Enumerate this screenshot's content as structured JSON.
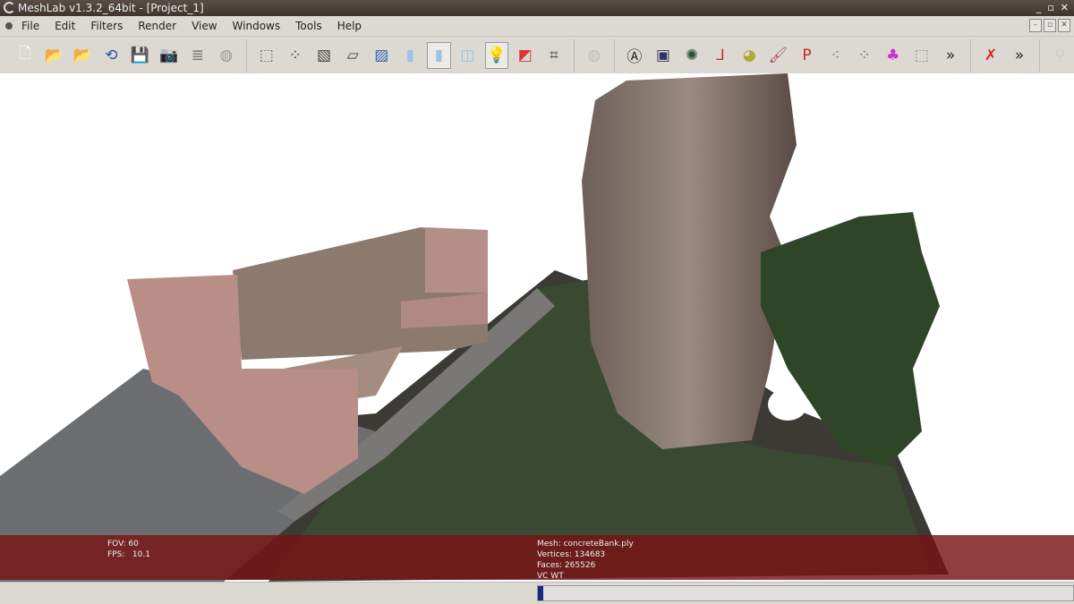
{
  "window": {
    "title": "MeshLab v1.3.2_64bit - [Project_1]",
    "controls": [
      "_",
      "▫",
      "✕"
    ]
  },
  "menu": [
    "File",
    "Edit",
    "Filters",
    "Render",
    "View",
    "Windows",
    "Tools",
    "Help"
  ],
  "mdi_controls": [
    "–",
    "▫",
    "✕"
  ],
  "toolbar": {
    "groups": [
      [
        {
          "name": "new-icon",
          "glyph": "🗋",
          "color": "#fff"
        },
        {
          "name": "open-project-icon",
          "glyph": "📂",
          "color": "#c8c820"
        },
        {
          "name": "import-mesh-icon",
          "glyph": "📂",
          "color": "#c8c820"
        },
        {
          "name": "reload-icon",
          "glyph": "⟲",
          "color": "#3355aa"
        },
        {
          "name": "save-icon",
          "glyph": "💾",
          "color": "#555"
        },
        {
          "name": "snapshot-icon",
          "glyph": "📷",
          "color": "#2a8"
        },
        {
          "name": "layers-icon",
          "glyph": "≣",
          "color": "#777"
        },
        {
          "name": "globe-icon",
          "glyph": "◍",
          "color": "#999"
        }
      ],
      [
        {
          "name": "bbox-icon",
          "glyph": "⬚",
          "color": "#666"
        },
        {
          "name": "points-icon",
          "glyph": "⁘",
          "color": "#444"
        },
        {
          "name": "wireframe-icon",
          "glyph": "▧",
          "color": "#444"
        },
        {
          "name": "hidden-lines-icon",
          "glyph": "▱",
          "color": "#444"
        },
        {
          "name": "flat-lines-icon",
          "glyph": "▨",
          "color": "#3366aa"
        },
        {
          "name": "flat-icon",
          "glyph": "▮",
          "color": "#9bc3e8"
        },
        {
          "name": "smooth-icon",
          "glyph": "▮",
          "color": "#9bc3e8",
          "on": true
        },
        {
          "name": "texture-icon",
          "glyph": "◫",
          "color": "#9bc3e8"
        },
        {
          "name": "light-icon",
          "glyph": "💡",
          "color": "#ee0",
          "on": true
        },
        {
          "name": "double-side-icon",
          "glyph": "◩",
          "color": "#d33"
        },
        {
          "name": "normals-icon",
          "glyph": "⌗",
          "color": "#555"
        }
      ],
      [
        {
          "name": "trackball-icon",
          "glyph": "◍",
          "color": "#bbb"
        }
      ],
      [
        {
          "name": "annotation-icon",
          "glyph": "Ⓐ",
          "color": "#222"
        },
        {
          "name": "shader-icon",
          "glyph": "▣",
          "color": "#336"
        },
        {
          "name": "paint-mesh-icon",
          "glyph": "✺",
          "color": "#253"
        },
        {
          "name": "axes-icon",
          "glyph": "⅃",
          "color": "#c33"
        },
        {
          "name": "measure-icon",
          "glyph": "◕",
          "color": "#aa3"
        },
        {
          "name": "brush-icon",
          "glyph": "🖌",
          "color": "#a55"
        },
        {
          "name": "pp-icon",
          "glyph": "P",
          "color": "#c22"
        },
        {
          "name": "select-vertices-icon",
          "glyph": "⁖",
          "color": "#777"
        },
        {
          "name": "select-connected-icon",
          "glyph": "⁘",
          "color": "#776"
        },
        {
          "name": "color-paint-icon",
          "glyph": "♣",
          "color": "#c3c"
        },
        {
          "name": "select-faces-icon",
          "glyph": "⬚",
          "color": "#888"
        },
        {
          "name": "more-icon",
          "glyph": "»",
          "color": "#222"
        }
      ],
      [
        {
          "name": "delete-icon",
          "glyph": "✗",
          "color": "#d22"
        },
        {
          "name": "more-icon",
          "glyph": "»",
          "color": "#222"
        }
      ],
      [
        {
          "name": "search-icon",
          "glyph": "⚲",
          "color": "#ccc"
        }
      ]
    ]
  },
  "overlay": {
    "fov": "FOV: 60",
    "fps": "FPS:   10.1",
    "mesh": "Mesh: concreteBank.ply",
    "vertices": "Vertices: 134683",
    "faces": "Faces: 265526",
    "extra": "VC WT"
  },
  "progress": 0.01
}
